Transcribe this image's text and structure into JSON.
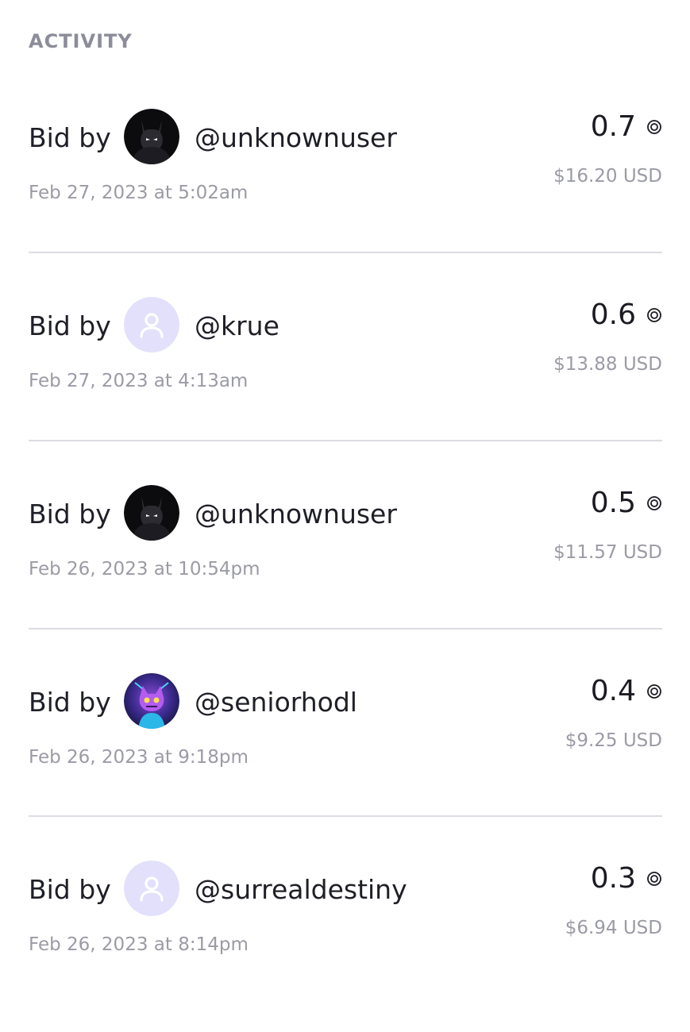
{
  "section": {
    "title": "ACTIVITY"
  },
  "activity": [
    {
      "label": "Bid by",
      "avatar": "batman-avatar",
      "username": "@unknownuser",
      "timestamp": "Feb 27, 2023 at 5:02am",
      "amount": "0.7",
      "usd": "$16.20 USD"
    },
    {
      "label": "Bid by",
      "avatar": "default-user-avatar",
      "username": "@krue",
      "timestamp": "Feb 27, 2023 at 4:13am",
      "amount": "0.6",
      "usd": "$13.88 USD"
    },
    {
      "label": "Bid by",
      "avatar": "batman-avatar",
      "username": "@unknownuser",
      "timestamp": "Feb 26, 2023 at 10:54pm",
      "amount": "0.5",
      "usd": "$11.57 USD"
    },
    {
      "label": "Bid by",
      "avatar": "purple-creature-avatar",
      "username": "@seniorhodl",
      "timestamp": "Feb 26, 2023 at 9:18pm",
      "amount": "0.4",
      "usd": "$9.25 USD"
    },
    {
      "label": "Bid by",
      "avatar": "default-user-avatar",
      "username": "@surrealdestiny",
      "timestamp": "Feb 26, 2023 at 8:14pm",
      "amount": "0.3",
      "usd": "$6.94 USD"
    }
  ],
  "colors": {
    "section_title": "#8c8c9a",
    "primary_text": "#1f1f28",
    "secondary_text": "#9b9ba6",
    "divider": "#dcdce4",
    "default_avatar_bg": "#e3e0fb",
    "default_avatar_fg": "#ffffff"
  },
  "icons": {
    "currency": "coin-icon",
    "default_avatar": "user-icon"
  }
}
